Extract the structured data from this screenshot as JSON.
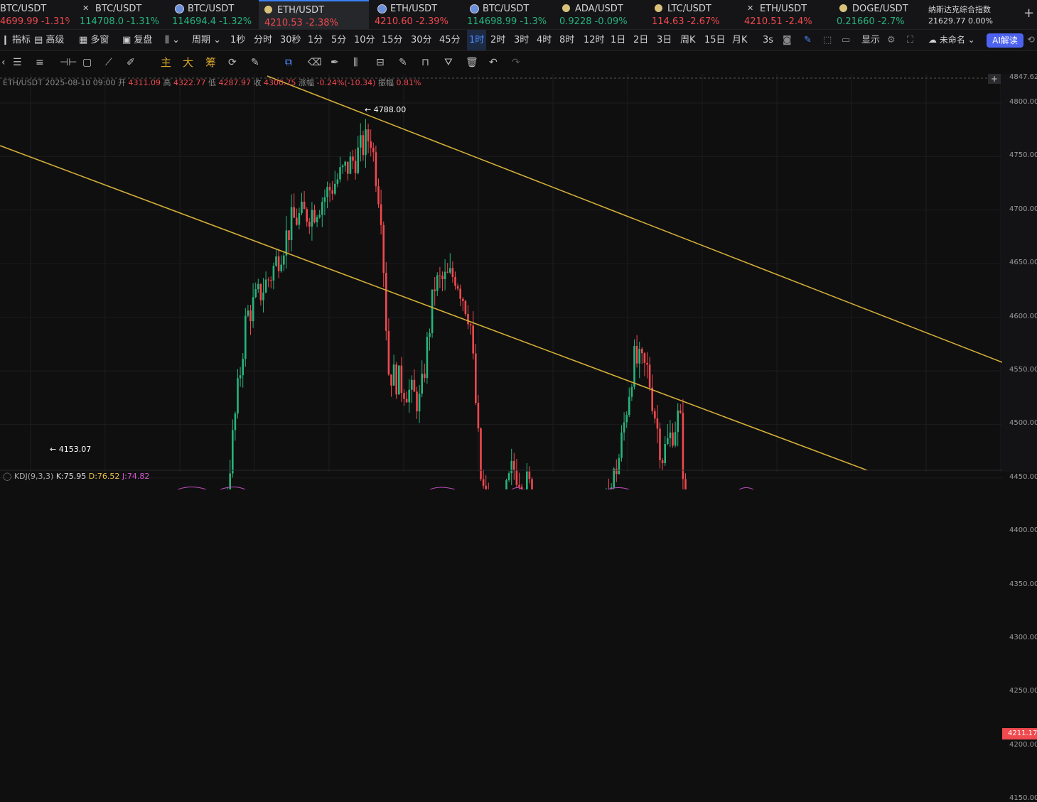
{
  "tickers": [
    {
      "name": "BTC/USDT",
      "price": "4699.99",
      "change": "-1.31%",
      "trend": "dn",
      "icon": "none"
    },
    {
      "name": "BTC/USDT",
      "price": "114708.0",
      "change": "-1.31%",
      "trend": "up",
      "icon": "x-icon"
    },
    {
      "name": "BTC/USDT",
      "price": "114694.4",
      "change": "-1.32%",
      "trend": "up",
      "icon": "globe-icon"
    },
    {
      "name": "ETH/USDT",
      "price": "4210.53",
      "change": "-2.38%",
      "trend": "dn",
      "icon": "coin-icon"
    },
    {
      "name": "ETH/USDT",
      "price": "4210.60",
      "change": "-2.39%",
      "trend": "dn",
      "icon": "globe-icon"
    },
    {
      "name": "BTC/USDT",
      "price": "114698.99",
      "change": "-1.3%",
      "trend": "up",
      "icon": "globe-icon"
    },
    {
      "name": "ADA/USDT",
      "price": "0.9228",
      "change": "-0.09%",
      "trend": "up",
      "icon": "coin-icon"
    },
    {
      "name": "LTC/USDT",
      "price": "114.63",
      "change": "-2.67%",
      "trend": "dn",
      "icon": "coin-icon"
    },
    {
      "name": "ETH/USDT",
      "price": "4210.51",
      "change": "-2.4%",
      "trend": "dn",
      "icon": "x-icon"
    },
    {
      "name": "DOGE/USDT",
      "price": "0.21660",
      "change": "-2.7%",
      "trend": "up",
      "icon": "coin-icon"
    },
    {
      "name": "纳斯达克综合指数",
      "price": "21629.77",
      "change": "0.00%",
      "trend": "flat",
      "icon": "none"
    }
  ],
  "toolbar": {
    "indicators": "指标",
    "advanced": "高级",
    "multi_window": "多窗",
    "replay": "复盘",
    "period": "周期",
    "periods": [
      "1秒",
      "分时",
      "30秒",
      "1分",
      "5分",
      "10分",
      "15分",
      "30分",
      "45分",
      "1时",
      "2时",
      "3时",
      "4时",
      "8时",
      "12时",
      "1日",
      "2日",
      "3日",
      "周K",
      "15日",
      "月K"
    ],
    "selected_period": "1时",
    "refresh": "3s",
    "display": "显示",
    "unnamed": "未命名",
    "ai_read": "AI解读"
  },
  "drawbar": {
    "main": "主",
    "big": "大",
    "chip": "筹"
  },
  "info": {
    "symbol": "ETH/USDT",
    "datetime": "2025-08-10 09:00",
    "open_label": "开",
    "open": "4311.09",
    "high_label": "高",
    "high": "4322.77",
    "low_label": "低",
    "low": "4287.97",
    "close_label": "收",
    "close": "4300.75",
    "change_label": "涨幅",
    "change": "-0.24%(-10.34)",
    "amp_label": "振幅",
    "amp": "0.81%"
  },
  "kdj": {
    "name": "KDJ(9,3,3)",
    "k": "K:75.95",
    "d": "D:76.52",
    "j": "J:74.82"
  },
  "chart_data": {
    "type": "candlestick",
    "y_ticks": [
      4847.62,
      4800.0,
      4750.0,
      4700.0,
      4650.0,
      4600.0,
      4550.0,
      4500.0,
      4450.0,
      4400.0,
      4350.0,
      4300.0,
      4250.0,
      4200.0,
      4150.0
    ],
    "ylim": [
      4120,
      4850
    ],
    "last_price_label": "4211.17",
    "high_marker": "4788.00",
    "low_marker": "4153.07",
    "colors": {
      "up": "#27b37b",
      "down": "#f0494e",
      "trendline": "#d4af37"
    }
  }
}
